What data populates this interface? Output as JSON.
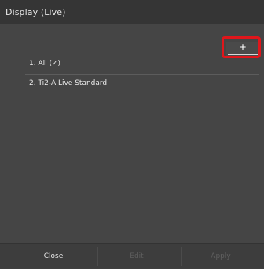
{
  "window": {
    "title": "Display (Live)"
  },
  "toolbar": {
    "add_label": "+"
  },
  "list": {
    "items": [
      {
        "label": "1. All (✓)"
      },
      {
        "label": "2. Ti2-A Live Standard"
      }
    ]
  },
  "footer": {
    "close_label": "Close",
    "edit_label": "Edit",
    "apply_label": "Apply"
  },
  "colors": {
    "highlight": "#e0161b",
    "background": "#454545",
    "disabled_text": "#5f5f5f"
  }
}
